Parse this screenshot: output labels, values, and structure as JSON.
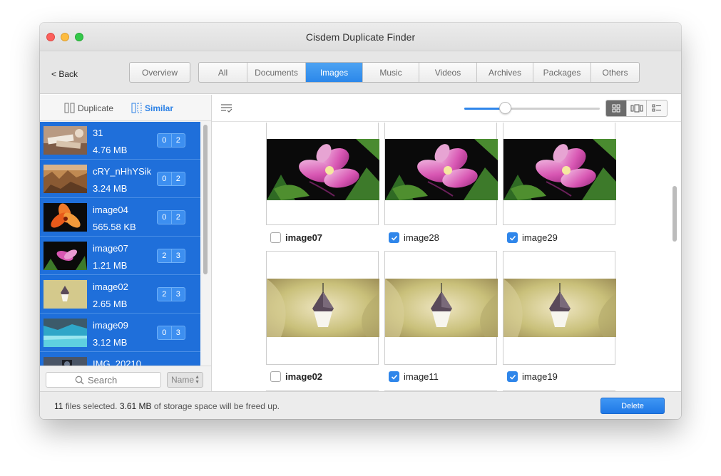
{
  "window": {
    "title": "Cisdem Duplicate Finder"
  },
  "toolbar": {
    "back_label": "< Back",
    "overview_label": "Overview",
    "tabs": [
      {
        "label": "All"
      },
      {
        "label": "Documents"
      },
      {
        "label": "Images",
        "active": true
      },
      {
        "label": "Music"
      },
      {
        "label": "Videos"
      },
      {
        "label": "Archives"
      },
      {
        "label": "Packages"
      },
      {
        "label": "Others"
      }
    ]
  },
  "sidebar": {
    "modes": {
      "duplicate": "Duplicate",
      "similar": "Similar",
      "active": "similar"
    },
    "items": [
      {
        "name": "31",
        "size": "4.76 MB",
        "selected": "0",
        "total": "2",
        "thumb": "books-thumb"
      },
      {
        "name": "cRY_nHhYSik",
        "size": "3.24 MB",
        "selected": "0",
        "total": "2",
        "thumb": "canyon-thumb"
      },
      {
        "name": "image04",
        "size": "565.58 KB",
        "selected": "0",
        "total": "2",
        "thumb": "lily-thumb"
      },
      {
        "name": "image07",
        "size": "1.21 MB",
        "selected": "2",
        "total": "3",
        "thumb": "orchid-thumb"
      },
      {
        "name": "image02",
        "size": "2.65 MB",
        "selected": "2",
        "total": "3",
        "thumb": "boat-thumb"
      },
      {
        "name": "image09",
        "size": "3.12 MB",
        "selected": "0",
        "total": "3",
        "thumb": "lake-thumb"
      },
      {
        "name": "IMG_20210",
        "size": "",
        "selected": "",
        "total": "",
        "thumb": "camera-thumb"
      }
    ],
    "search_placeholder": "Search",
    "sort_label": "Name"
  },
  "content": {
    "slider_level": 0.3,
    "view_modes": [
      "grid-view",
      "filmstrip-view",
      "list-view"
    ],
    "active_view": "grid-view",
    "groups": [
      {
        "image": "orchid",
        "files": [
          {
            "name": "image07",
            "checked": false
          },
          {
            "name": "image28",
            "checked": true
          },
          {
            "name": "image29",
            "checked": true
          }
        ]
      },
      {
        "image": "boat",
        "files": [
          {
            "name": "image02",
            "checked": false
          },
          {
            "name": "image11",
            "checked": true
          },
          {
            "name": "image19",
            "checked": true
          }
        ]
      }
    ]
  },
  "status": {
    "files_count": "11",
    "files_text": " files selected. ",
    "size": "3.61 MB",
    "size_text": " of storage space will be freed up."
  },
  "delete_label": "Delete",
  "colors": {
    "accent": "#2f86ea",
    "selection": "#1f6fda"
  }
}
